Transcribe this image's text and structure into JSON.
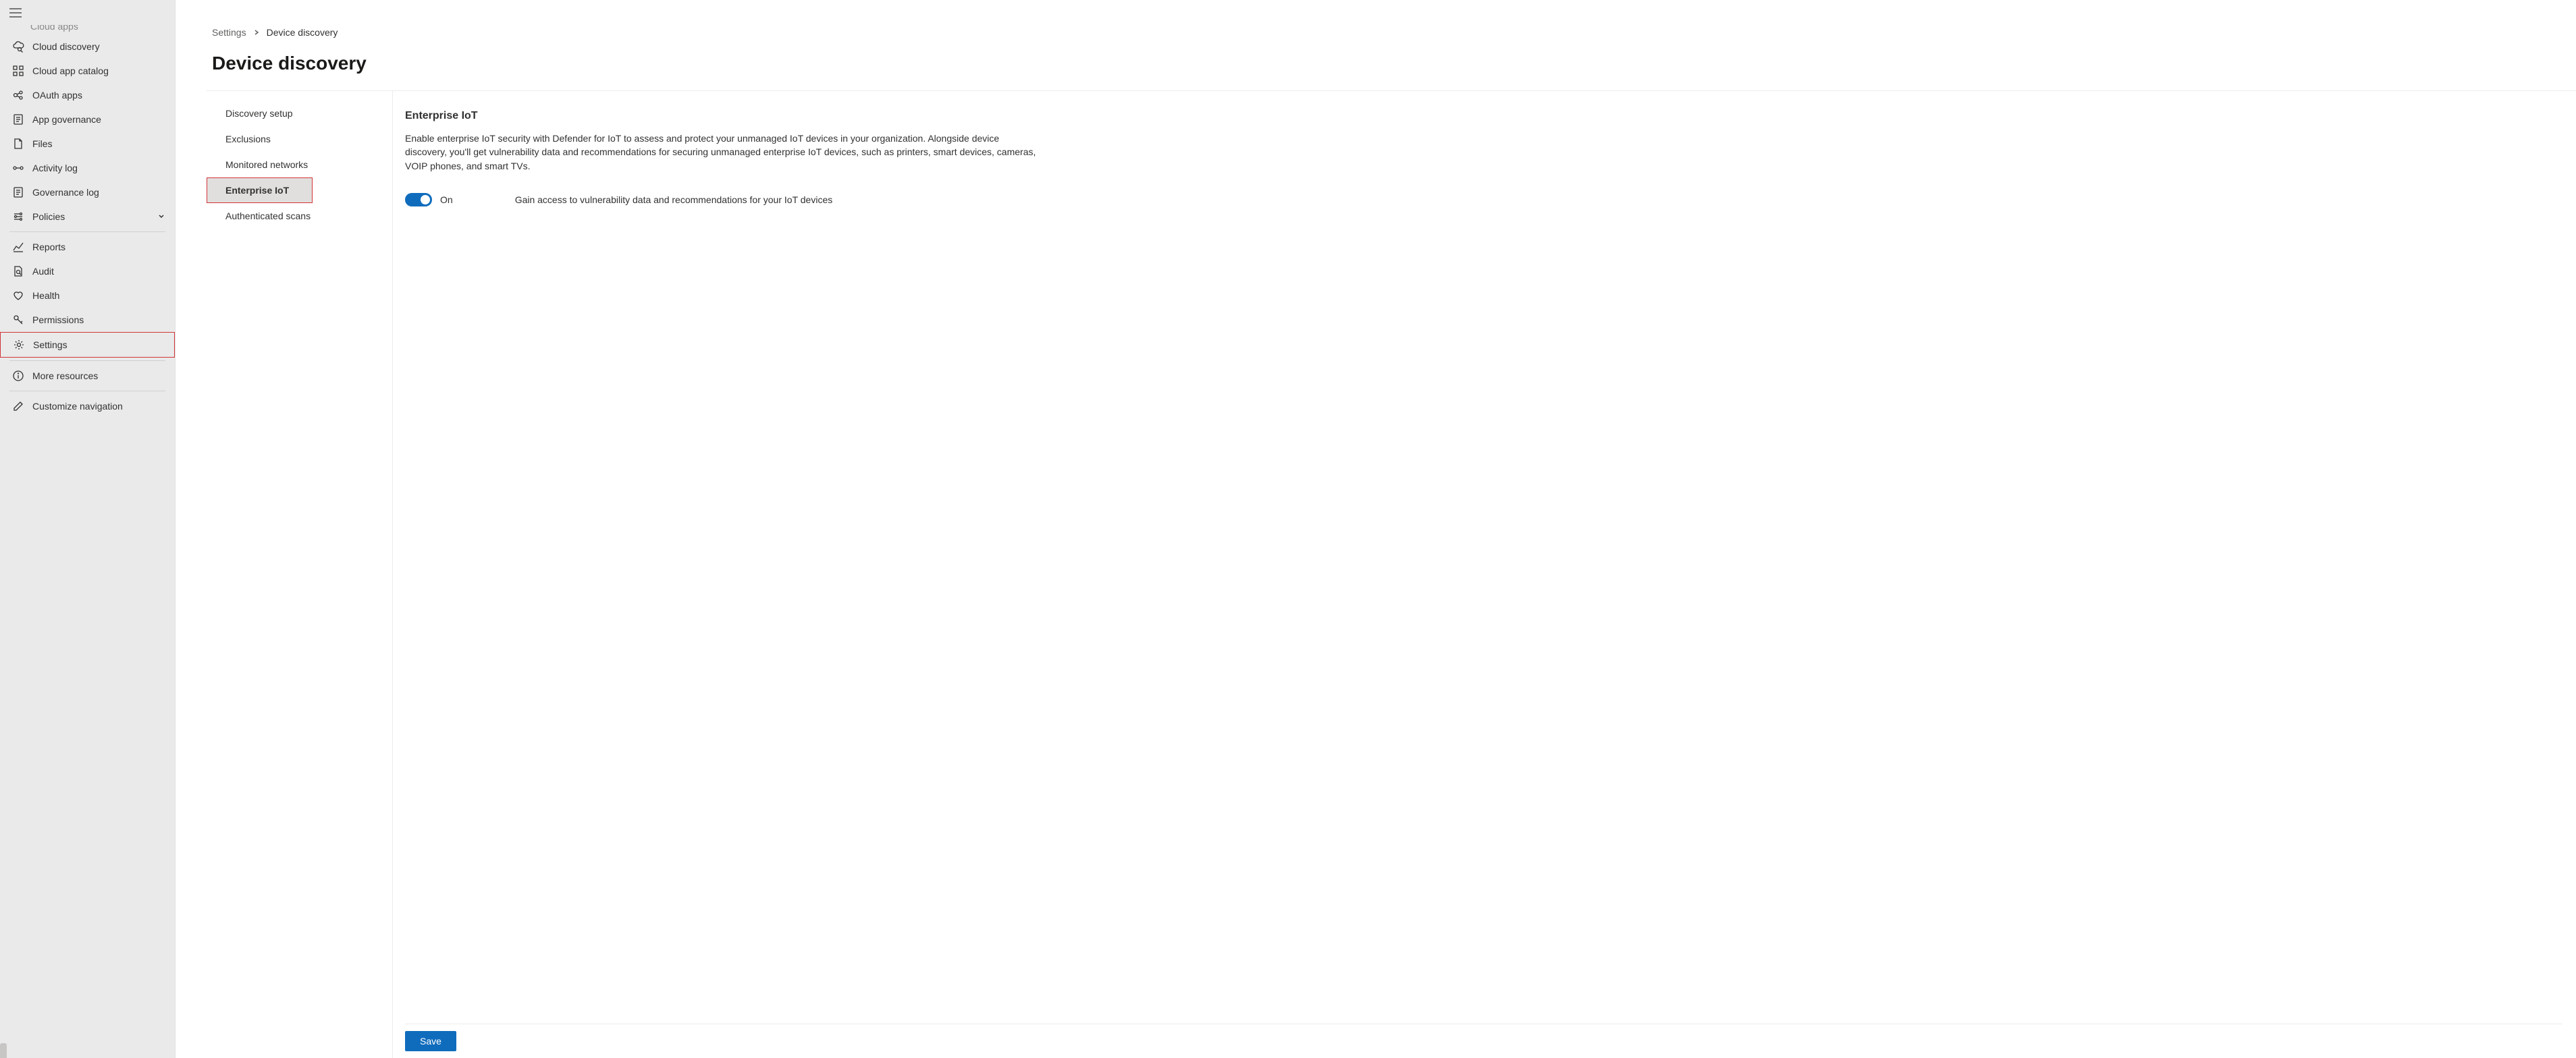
{
  "sidebar": {
    "truncated_label": "Cloud apps",
    "items": [
      {
        "icon": "cloud-discovery",
        "label": "Cloud discovery"
      },
      {
        "icon": "catalog",
        "label": "Cloud app catalog"
      },
      {
        "icon": "oauth",
        "label": "OAuth apps"
      },
      {
        "icon": "governance",
        "label": "App governance"
      },
      {
        "icon": "files",
        "label": "Files"
      },
      {
        "icon": "activity",
        "label": "Activity log"
      },
      {
        "icon": "governance-log",
        "label": "Governance log"
      },
      {
        "icon": "policies",
        "label": "Policies",
        "expandable": true
      }
    ],
    "section2": [
      {
        "icon": "reports",
        "label": "Reports"
      },
      {
        "icon": "audit",
        "label": "Audit"
      },
      {
        "icon": "health",
        "label": "Health"
      },
      {
        "icon": "permissions",
        "label": "Permissions"
      },
      {
        "icon": "settings",
        "label": "Settings",
        "highlight": true
      }
    ],
    "section3": [
      {
        "icon": "info",
        "label": "More resources"
      }
    ],
    "section4": [
      {
        "icon": "edit",
        "label": "Customize navigation"
      }
    ]
  },
  "breadcrumb": {
    "root": "Settings",
    "current": "Device discovery"
  },
  "page_title": "Device discovery",
  "subnav": {
    "items": [
      {
        "label": "Discovery setup"
      },
      {
        "label": "Exclusions"
      },
      {
        "label": "Monitored networks"
      },
      {
        "label": "Enterprise IoT",
        "selected": true,
        "redbox": true
      },
      {
        "label": "Authenticated scans"
      }
    ]
  },
  "detail": {
    "title": "Enterprise IoT",
    "description": "Enable enterprise IoT security with Defender for IoT to assess and protect your unmanaged IoT devices in your organization. Alongside device discovery, you'll get vulnerability data and recommendations for securing unmanaged enterprise IoT devices, such as printers, smart devices, cameras, VOIP phones, and smart TVs.",
    "toggle_state": "On",
    "toggle_desc": "Gain access to vulnerability data and recommendations for your IoT devices",
    "save_label": "Save"
  }
}
